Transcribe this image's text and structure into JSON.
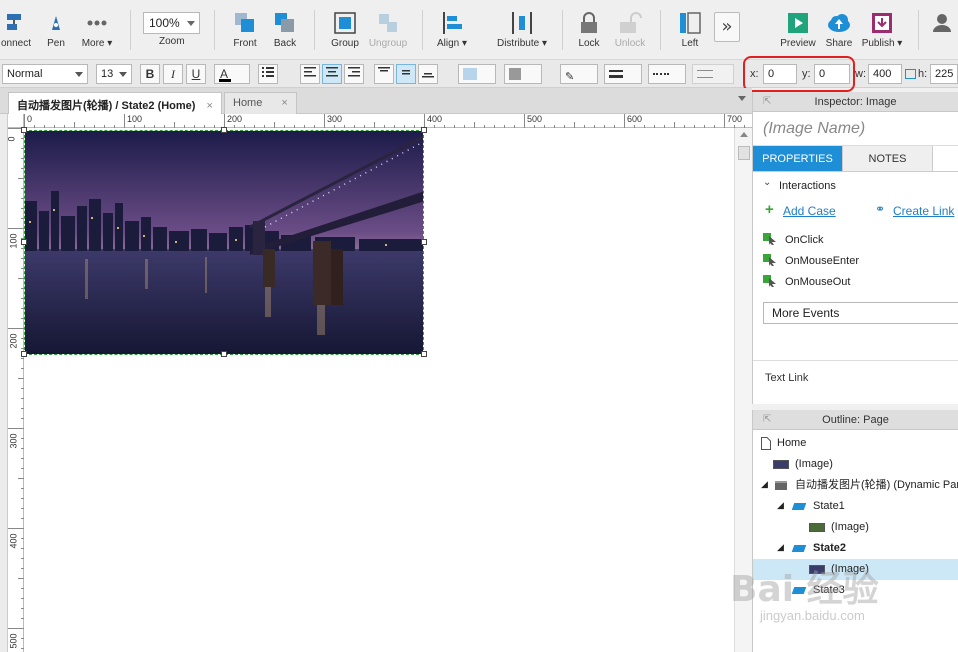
{
  "toolbar": {
    "connect": "onnect",
    "pen": "Pen",
    "more": "More ▾",
    "zoom_value": "100%",
    "zoom_label": "Zoom",
    "front": "Front",
    "back": "Back",
    "group": "Group",
    "ungroup": "Ungroup",
    "align": "Align ▾",
    "distribute": "Distribute ▾",
    "lock": "Lock",
    "unlock": "Unlock",
    "left": "Left",
    "overflow": "»",
    "preview": "Preview",
    "share": "Share",
    "publish": "Publish ▾"
  },
  "formatbar": {
    "style": "Normal",
    "font_size": "13",
    "bold": "B",
    "italic": "I",
    "underline": "U",
    "font_color": "A",
    "x_label": "x:",
    "x_value": "0",
    "y_label": "y:",
    "y_value": "0",
    "w_label": "w:",
    "w_value": "400",
    "h_label": "h:",
    "h_value": "225"
  },
  "tabs": [
    {
      "label": "自动播发图片(轮播) / State2 (Home)",
      "close": "×"
    },
    {
      "label": "Home",
      "close": "×"
    }
  ],
  "ruler": {
    "h_ticks": [
      "0",
      "100",
      "200",
      "300",
      "400",
      "500",
      "600",
      "700"
    ],
    "v_ticks": [
      "0",
      "100",
      "200",
      "300",
      "400",
      "500"
    ]
  },
  "inspector": {
    "title": "Inspector: Image",
    "image_name_placeholder": "(Image Name)",
    "tab_properties": "PROPERTIES",
    "tab_notes": "NOTES",
    "interactions_label": "Interactions",
    "add_case": "Add Case",
    "create_link": "Create Link",
    "events": [
      "OnClick",
      "OnMouseEnter",
      "OnMouseOut"
    ],
    "more_events": "More Events",
    "text_link": "Text Link"
  },
  "outline": {
    "title": "Outline: Page",
    "rows": [
      {
        "label": "Home"
      },
      {
        "label": "(Image)"
      },
      {
        "label": "自动播发图片(轮播) (Dynamic Panel)"
      },
      {
        "label": "State1"
      },
      {
        "label": "(Image)"
      },
      {
        "label": "State2"
      },
      {
        "label": "(Image)"
      },
      {
        "label": "State3"
      }
    ]
  },
  "watermark": {
    "text": "Bai 经验",
    "sub": "jingyan.baidu.com"
  },
  "colors": {
    "accent": "#1e8fd6",
    "highlight": "#e02020",
    "selection": "#cce8f7"
  }
}
